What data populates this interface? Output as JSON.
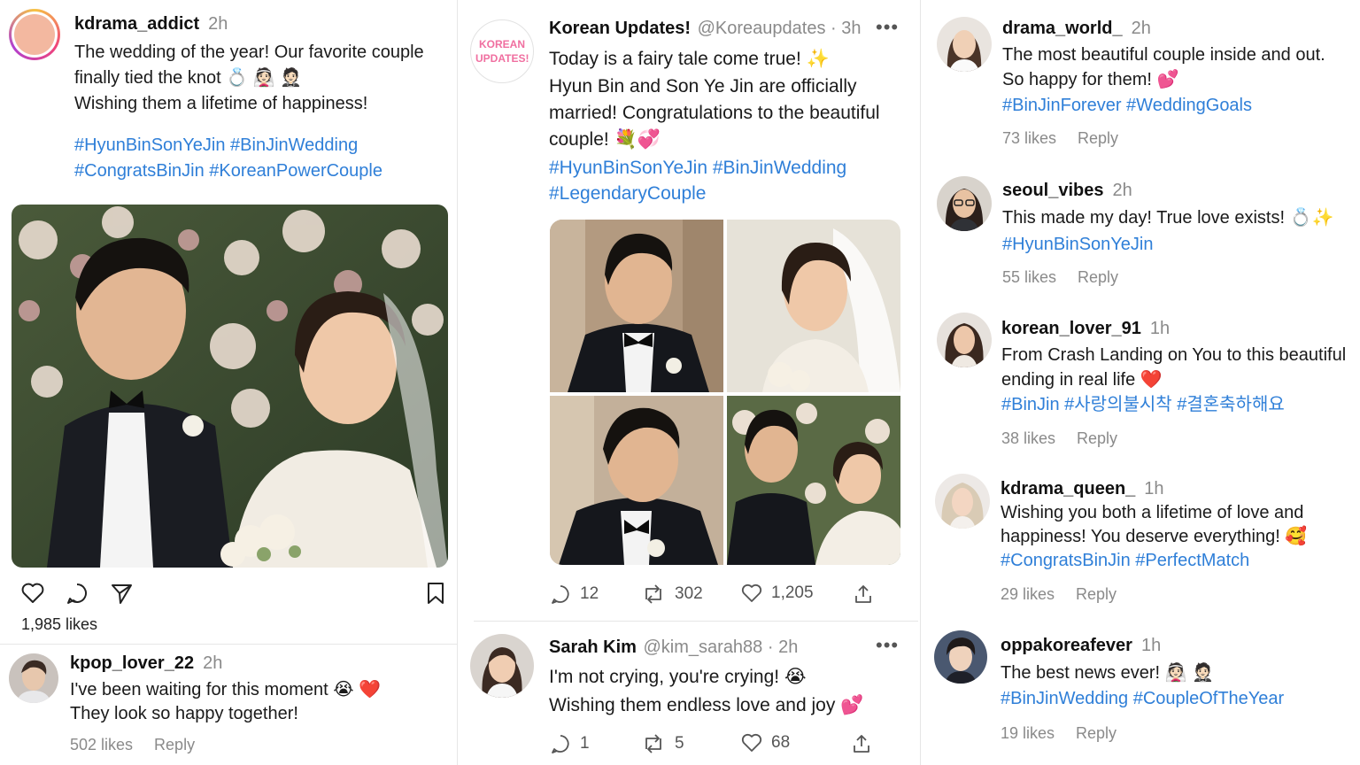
{
  "post": {
    "username": "kdrama_addict",
    "time": "2h",
    "lines": [
      "The wedding of the year! Our favorite couple",
      "finally tied the knot 💍 👰🏻 🤵🏻",
      "Wishing them a lifetime of happiness!"
    ],
    "hashtags": [
      "#HyunBinSonYeJin #BinJinWedding",
      "#CongratsBinJin #KoreanPowerCouple"
    ],
    "likes": "1,985 likes",
    "comment": {
      "username": "kpop_lover_22",
      "time": "2h",
      "lines": [
        "I've been waiting for this moment 😭 ❤️",
        "They look so happy together!"
      ],
      "likes": "502 likes",
      "reply": "Reply"
    }
  },
  "tweet": {
    "avatar_text": "KOREAN UPDATES!",
    "name": "Korean Updates!",
    "handle_time": "@Koreaupdates · 3h",
    "lines": [
      "Today is a fairy tale come true! ✨",
      "Hyun Bin and Son Ye Jin are officially",
      "married! Congratulations to the beautiful",
      "couple! 💐💞"
    ],
    "hashtags": [
      "#HyunBinSonYeJin #BinJinWedding",
      "#LegendaryCouple"
    ],
    "replies": "12",
    "retweets": "302",
    "likes": "1,205",
    "reply_tweet": {
      "name": "Sarah Kim",
      "handle_time": "@kim_sarah88 · 2h",
      "lines": [
        "I'm not crying, you're crying! 😭",
        "Wishing them endless love and joy 💕"
      ],
      "replies": "1",
      "retweets": "5",
      "likes": "68"
    }
  },
  "comments": [
    {
      "username": "drama_world_",
      "time": "2h",
      "lines": [
        "The most beautiful couple inside and out.",
        "So happy for them! 💕"
      ],
      "hashtags": "#BinJinForever #WeddingGoals",
      "likes": "73 likes",
      "reply": "Reply"
    },
    {
      "username": "seoul_vibes",
      "time": "2h",
      "lines": [
        "This made my day! True love exists! 💍✨"
      ],
      "hashtags": "#HyunBinSonYeJin",
      "likes": "55 likes",
      "reply": "Reply"
    },
    {
      "username": "korean_lover_91",
      "time": "1h",
      "lines": [
        "From Crash Landing on You to this beautiful",
        "ending in real life ❤️"
      ],
      "hashtags": "#BinJin #사랑의불시착 #결혼축하해요",
      "likes": "38 likes",
      "reply": "Reply"
    },
    {
      "username": "kdrama_queen_",
      "time": "1h",
      "lines": [
        "Wishing you both a lifetime of love and",
        "happiness! You deserve everything! 🥰"
      ],
      "hashtags": "#CongratsBinJin #PerfectMatch",
      "likes": "29 likes",
      "reply": "Reply"
    },
    {
      "username": "oppakoreafever",
      "time": "1h",
      "lines": [
        "The best news ever! 👰🏻 🤵🏻"
      ],
      "hashtags": "#BinJinWedding #CoupleOfTheYear",
      "likes": "19 likes",
      "reply": "Reply"
    }
  ],
  "colors": {
    "hashtag": "#2f7fd8",
    "muted": "#8a8a8a",
    "divider": "#e6e6e6",
    "brand_pink": "#f06fa0"
  }
}
